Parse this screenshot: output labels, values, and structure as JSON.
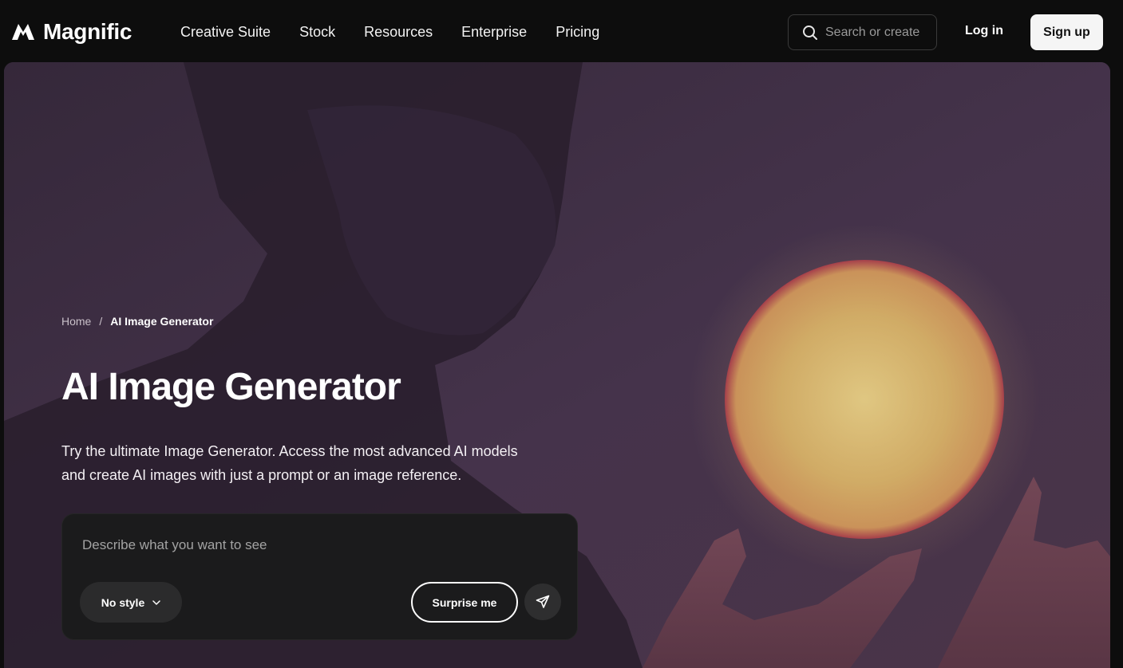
{
  "brand": {
    "name": "Magnific"
  },
  "nav": {
    "links": [
      "Creative Suite",
      "Stock",
      "Resources",
      "Enterprise",
      "Pricing"
    ],
    "search_placeholder": "Search or create",
    "login_label": "Log in",
    "signup_label": "Sign up"
  },
  "breadcrumb": {
    "home": "Home",
    "separator": "/",
    "current": "AI Image Generator"
  },
  "hero": {
    "title": "AI Image Generator",
    "description": "Try the ultimate Image Generator. Access the most advanced AI models and create AI images with just a prompt or an image reference."
  },
  "prompt": {
    "placeholder": "Describe what you want to see",
    "value": "",
    "style_label": "No style",
    "surprise_label": "Surprise me"
  },
  "colors": {
    "background": "#0d0d0d",
    "hero_tint": "#3e2e43",
    "card": "#1b1b1c",
    "orb": "#e8c06a"
  },
  "icons": [
    "magnific-logo-icon",
    "search-icon",
    "chevron-down-icon",
    "send-icon"
  ]
}
